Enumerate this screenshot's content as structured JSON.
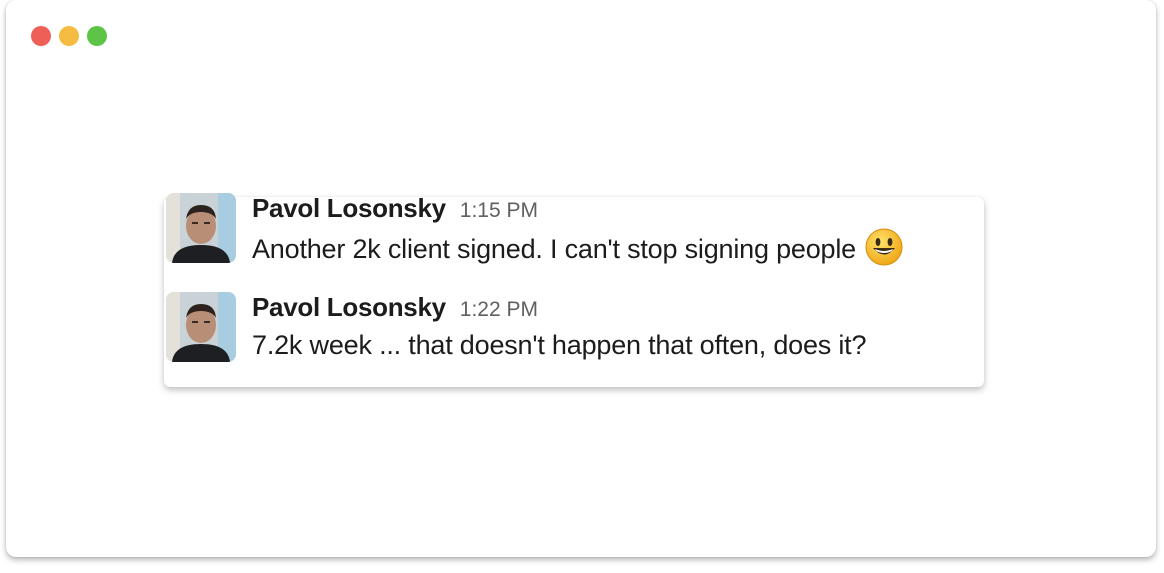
{
  "window": {
    "controls": [
      {
        "name": "close",
        "color": "#ee5f58"
      },
      {
        "name": "minimize",
        "color": "#f5bc42"
      },
      {
        "name": "maximize",
        "color": "#5cc446"
      }
    ]
  },
  "messages": [
    {
      "author": "Pavol Losonsky",
      "time": "1:15 PM",
      "text": "Another 2k client signed. I can't stop signing people",
      "emoji": "grinning-face-emoji"
    },
    {
      "author": "Pavol Losonsky",
      "time": "1:22 PM",
      "text": "7.2k week ... that doesn't happen that often, does it?"
    }
  ]
}
